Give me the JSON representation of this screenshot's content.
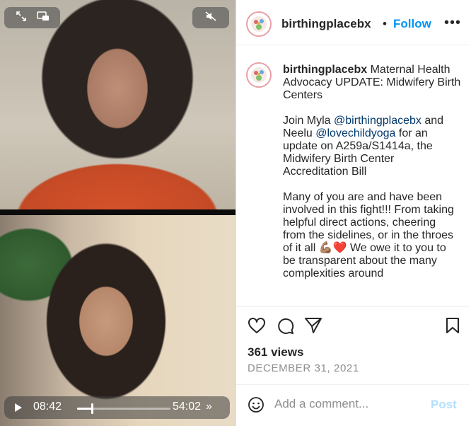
{
  "video": {
    "current_time": "08:42",
    "total_time": "54:02",
    "progress_fraction": 0.16,
    "ff_glyph": "»",
    "icons": {
      "expand": "expand-icon",
      "pip": "picture-in-picture-icon",
      "mute": "muted-speaker-icon",
      "play": "play-icon"
    }
  },
  "header": {
    "username": "birthingplacebx",
    "separator": "•",
    "follow_label": "Follow",
    "more_label": "•••"
  },
  "caption": {
    "username": "birthingplacebx",
    "title": "Maternal Health Advocacy UPDATE: Midwifery Birth Centers",
    "p2_a": "Join Myla ",
    "mention1": "@birthingplacebx",
    "p2_b": " and Neelu ",
    "mention2": "@lovechildyoga",
    "p2_c": " for an update on A259a/S1414a, the Midwifery Birth Center Accreditation Bill",
    "p3_a": "Many of you are and have been involved in this fight!!! From taking helpful direct actions, cheering from the sidelines, or in the throes of it all ",
    "p3_emoji": "💪🏽❤️",
    "p3_b": " We owe it to you to be transparent about the many complexities around"
  },
  "stats": {
    "views": "361 views",
    "date": "DECEMBER 31, 2021"
  },
  "comment": {
    "placeholder": "Add a comment...",
    "post_label": "Post"
  },
  "colors": {
    "follow": "#0095f6",
    "mention": "#00376b",
    "post_disabled": "#b2dffc",
    "muted_text": "#8e8e8e"
  }
}
